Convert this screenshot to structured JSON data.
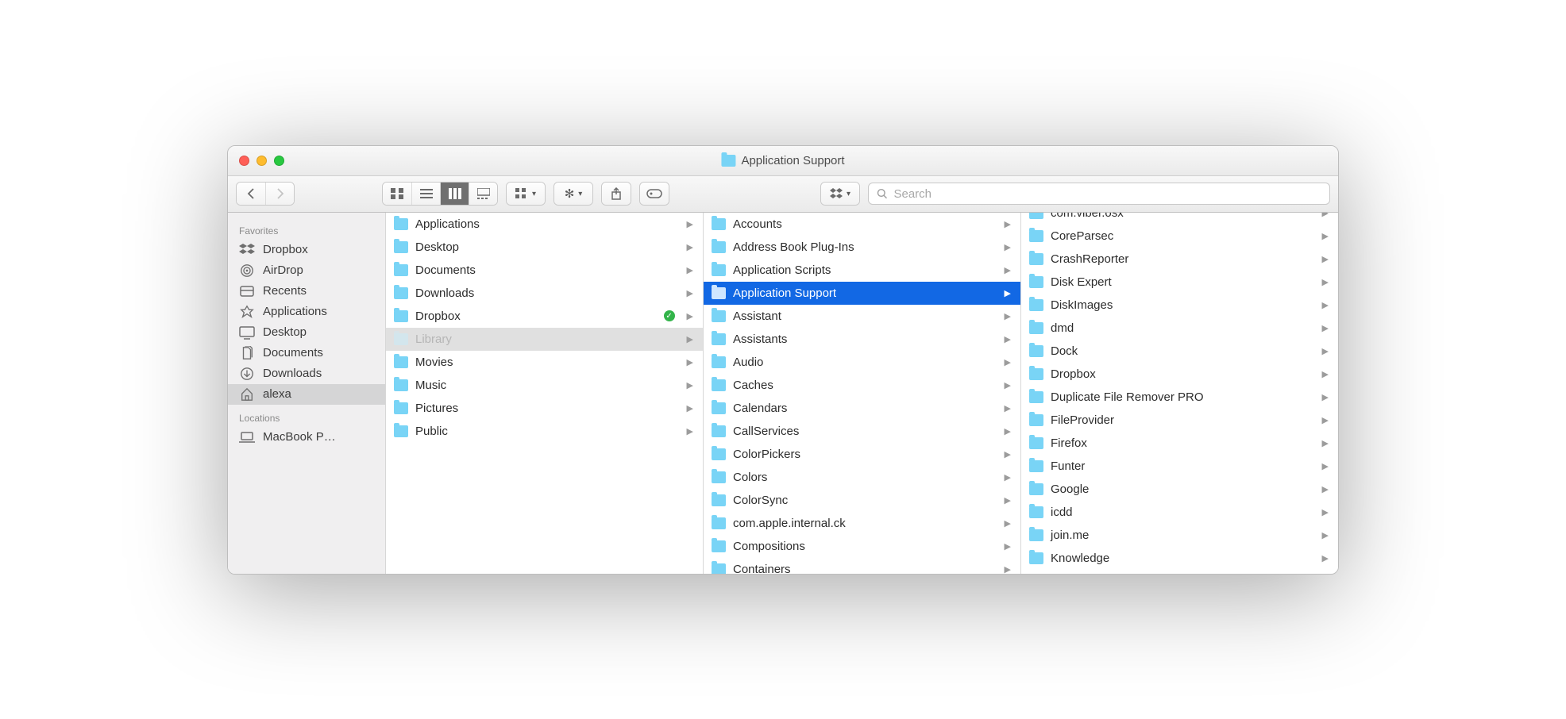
{
  "window": {
    "title": "Application Support"
  },
  "search": {
    "placeholder": "Search"
  },
  "sidebar": {
    "sections": [
      {
        "heading": "Favorites",
        "items": [
          {
            "label": "Dropbox",
            "icon": "dropbox"
          },
          {
            "label": "AirDrop",
            "icon": "airdrop"
          },
          {
            "label": "Recents",
            "icon": "recents"
          },
          {
            "label": "Applications",
            "icon": "apps"
          },
          {
            "label": "Desktop",
            "icon": "desktop"
          },
          {
            "label": "Documents",
            "icon": "documents"
          },
          {
            "label": "Downloads",
            "icon": "downloads"
          },
          {
            "label": "alexa",
            "icon": "home",
            "selected": true
          }
        ]
      },
      {
        "heading": "Locations",
        "items": [
          {
            "label": "MacBook P…",
            "icon": "laptop"
          }
        ]
      }
    ]
  },
  "columns": [
    {
      "items": [
        {
          "label": "Applications"
        },
        {
          "label": "Desktop"
        },
        {
          "label": "Documents"
        },
        {
          "label": "Downloads"
        },
        {
          "label": "Dropbox",
          "sync": true
        },
        {
          "label": "Library",
          "hidden": true,
          "selected": "grey"
        },
        {
          "label": "Movies"
        },
        {
          "label": "Music"
        },
        {
          "label": "Pictures"
        },
        {
          "label": "Public"
        }
      ]
    },
    {
      "items": [
        {
          "label": "Accounts"
        },
        {
          "label": "Address Book Plug-Ins"
        },
        {
          "label": "Application Scripts"
        },
        {
          "label": "Application Support",
          "selected": "blue"
        },
        {
          "label": "Assistant"
        },
        {
          "label": "Assistants"
        },
        {
          "label": "Audio"
        },
        {
          "label": "Caches"
        },
        {
          "label": "Calendars"
        },
        {
          "label": "CallServices"
        },
        {
          "label": "ColorPickers"
        },
        {
          "label": "Colors"
        },
        {
          "label": "ColorSync"
        },
        {
          "label": "com.apple.internal.ck"
        },
        {
          "label": "Compositions"
        },
        {
          "label": "Containers"
        }
      ]
    },
    {
      "items": [
        {
          "label": "com.viber.osx",
          "cut": true
        },
        {
          "label": "CoreParsec"
        },
        {
          "label": "CrashReporter"
        },
        {
          "label": "Disk Expert"
        },
        {
          "label": "DiskImages"
        },
        {
          "label": "dmd"
        },
        {
          "label": "Dock"
        },
        {
          "label": "Dropbox"
        },
        {
          "label": "Duplicate File Remover PRO"
        },
        {
          "label": "FileProvider"
        },
        {
          "label": "Firefox"
        },
        {
          "label": "Funter"
        },
        {
          "label": "Google"
        },
        {
          "label": "icdd"
        },
        {
          "label": "join.me"
        },
        {
          "label": "Knowledge"
        }
      ]
    }
  ]
}
